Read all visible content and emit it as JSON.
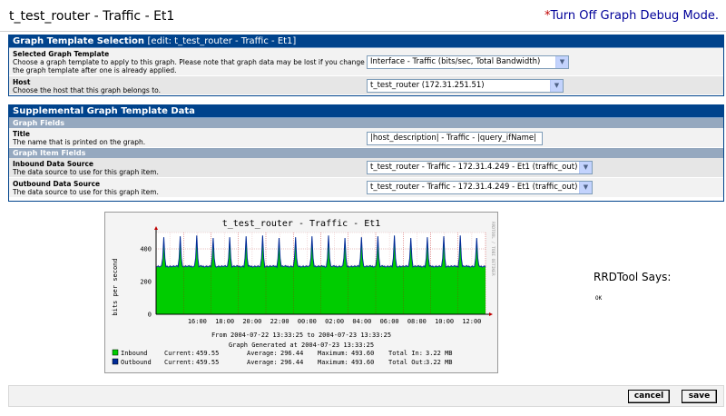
{
  "header": {
    "title": "t_test_router - Traffic - Et1",
    "debug_star": "*",
    "debug_link": "Turn Off Graph Debug Mode."
  },
  "template_panel": {
    "heading": "Graph Template Selection",
    "edit_note": "[edit: t_test_router - Traffic - Et1]",
    "template_label": "Selected Graph Template",
    "template_desc": "Choose a graph template to apply to this graph. Please note that graph data may be lost if you change the graph template after one is already applied.",
    "template_value": "Interface - Traffic (bits/sec, Total Bandwidth)",
    "host_label": "Host",
    "host_desc": "Choose the host that this graph belongs to.",
    "host_value": "t_test_router (172.31.251.51)"
  },
  "supplemental_panel": {
    "heading": "Supplemental Graph Template Data",
    "graph_fields_heading": "Graph Fields",
    "title_label": "Title",
    "title_desc": "The name that is printed on the graph.",
    "title_value": "|host_description| - Traffic - |query_ifName|",
    "item_fields_heading": "Graph Item Fields",
    "inbound_label": "Inbound Data Source",
    "inbound_desc": "The data source to use for this graph item.",
    "inbound_value": "t_test_router - Traffic - 172.31.4.249 - Et1 (traffic_out)",
    "outbound_label": "Outbound Data Source",
    "outbound_desc": "The data source to use for this graph item.",
    "outbound_value": "t_test_router - Traffic - 172.31.4.249 - Et1 (traffic_out)"
  },
  "rrdtool": {
    "says_label": "RRDTool Says:",
    "result": "OK"
  },
  "buttons": {
    "cancel": "cancel",
    "save": "save"
  },
  "colors": {
    "panel_header": "#00438c",
    "sub_header": "#95a8bf",
    "inbound": "#00cc00",
    "outbound": "#002a97",
    "link": "#000099"
  },
  "chart_data": {
    "type": "area",
    "title": "t_test_router - Traffic - Et1",
    "ylabel": "bits per second",
    "side_label": "RRDTOOL / TOBI OETIKER",
    "ylim": [
      0,
      500
    ],
    "yticks": [
      0,
      200,
      400
    ],
    "x_tick_labels": [
      "16:00",
      "18:00",
      "20:00",
      "22:00",
      "00:00",
      "02:00",
      "04:00",
      "06:00",
      "08:00",
      "10:00",
      "12:00"
    ],
    "grid": true,
    "period_line": "From 2004-07-22 13:33:25 to 2004-07-23 13:33:25",
    "generated_line": "Graph Generated at 2004-07-23 13:33:25",
    "series": [
      {
        "name": "Inbound",
        "color": "#00cc00",
        "style": "area",
        "baseline": 290,
        "spike_peak": 480
      },
      {
        "name": "Outbound",
        "color": "#002a97",
        "style": "line",
        "baseline": 290,
        "spike_peak": 480
      }
    ],
    "legend": [
      {
        "name": "Inbound",
        "current_label": "Current:",
        "current": "459.55",
        "average_label": "Average:",
        "average": "296.44",
        "maximum_label": "Maximum:",
        "maximum": "493.60",
        "total_label": "Total In:",
        "total": "3.22 MB"
      },
      {
        "name": "Outbound",
        "current_label": "Current:",
        "current": "459.55",
        "average_label": "Average:",
        "average": "296.44",
        "maximum_label": "Maximum:",
        "maximum": "493.60",
        "total_label": "Total Out:",
        "total": "3.22 MB"
      }
    ]
  }
}
